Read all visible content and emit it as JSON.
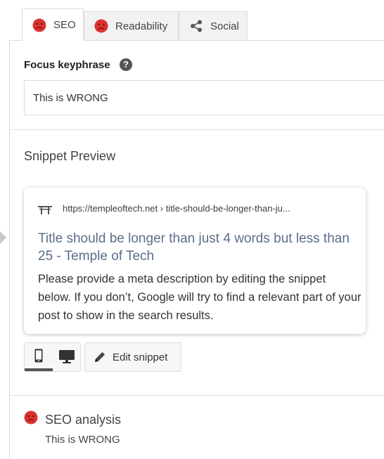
{
  "tabs": [
    {
      "label": "SEO",
      "icon": "sad-face-icon",
      "active": true
    },
    {
      "label": "Readability",
      "icon": "sad-face-icon",
      "active": false
    },
    {
      "label": "Social",
      "icon": "share-icon",
      "active": false
    }
  ],
  "focus_keyphrase": {
    "label": "Focus keyphrase",
    "help_icon": "question-mark-icon",
    "value": "This is WRONG"
  },
  "snippet_preview": {
    "heading": "Snippet Preview",
    "url": "https://templeoftech.net › title-should-be-longer-than-ju...",
    "title": "Title should be longer than just 4 words but less than 25 - Temple of Tech",
    "description": "Please provide a meta description by editing the snippet below. If you don’t, Google will try to find a relevant part of your post to show in the search results.",
    "mode_buttons": [
      "mobile-icon",
      "desktop-icon"
    ],
    "edit_label": "Edit snippet"
  },
  "seo_analysis": {
    "title": "SEO analysis",
    "keyphrase": "This is WRONG",
    "status_icon": "sad-face-icon"
  },
  "colors": {
    "bad": "#dc3232",
    "title_link": "#5b6e8a",
    "border": "#dcdcdc"
  }
}
